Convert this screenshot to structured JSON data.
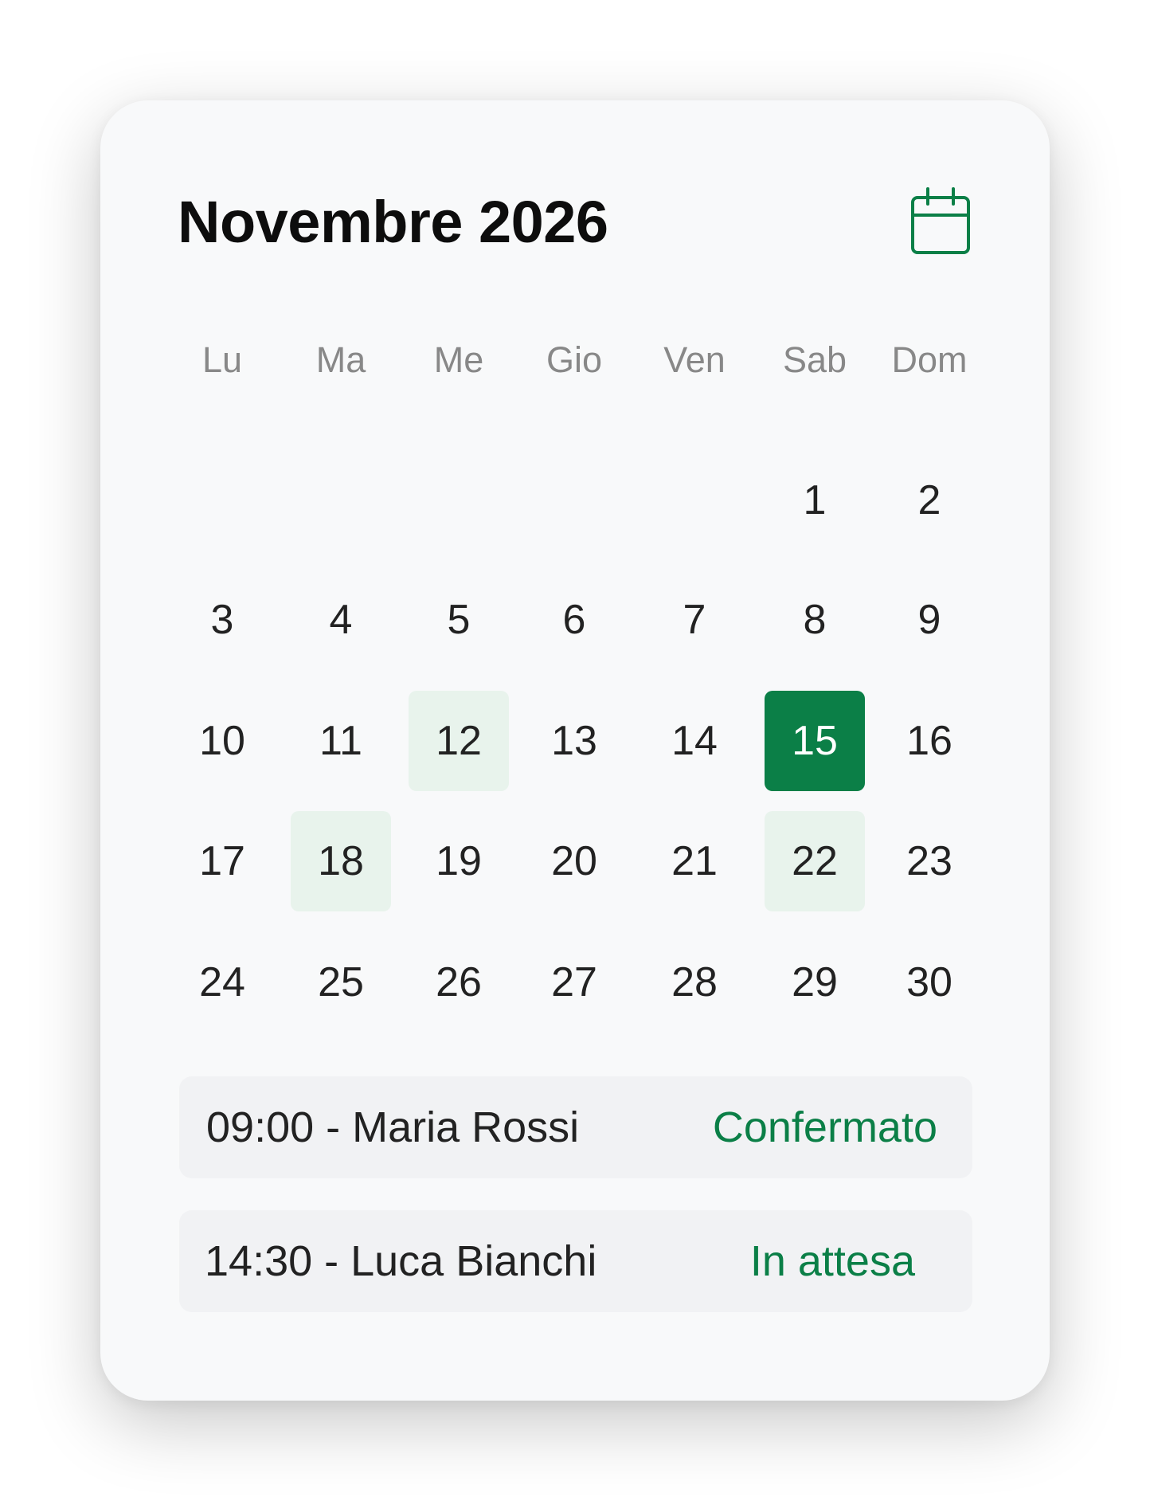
{
  "calendar": {
    "title": "Novembre 2026",
    "icon": "calendar-icon",
    "accent_color": "#0b7f47",
    "highlight_color": "#e8f3ec",
    "weekdays": [
      "Lu",
      "Ma",
      "Me",
      "Gio",
      "Ven",
      "Sab",
      "Dom"
    ],
    "weeks": [
      [
        "",
        "",
        "",
        "",
        "",
        "1",
        "2"
      ],
      [
        "3",
        "4",
        "5",
        "6",
        "7",
        "8",
        "9"
      ],
      [
        "10",
        "11",
        "12",
        "13",
        "14",
        "15",
        "16"
      ],
      [
        "17",
        "18",
        "19",
        "20",
        "21",
        "22",
        "23"
      ],
      [
        "24",
        "25",
        "26",
        "27",
        "28",
        "29",
        "30"
      ]
    ],
    "selected_day": "15",
    "days_with_appointments": [
      "12",
      "18",
      "22"
    ]
  },
  "appointments": [
    {
      "text": "09:00 - Maria Rossi",
      "status": "Confermato"
    },
    {
      "text": "14:30 - Luca Bianchi",
      "status": "In attesa"
    }
  ]
}
